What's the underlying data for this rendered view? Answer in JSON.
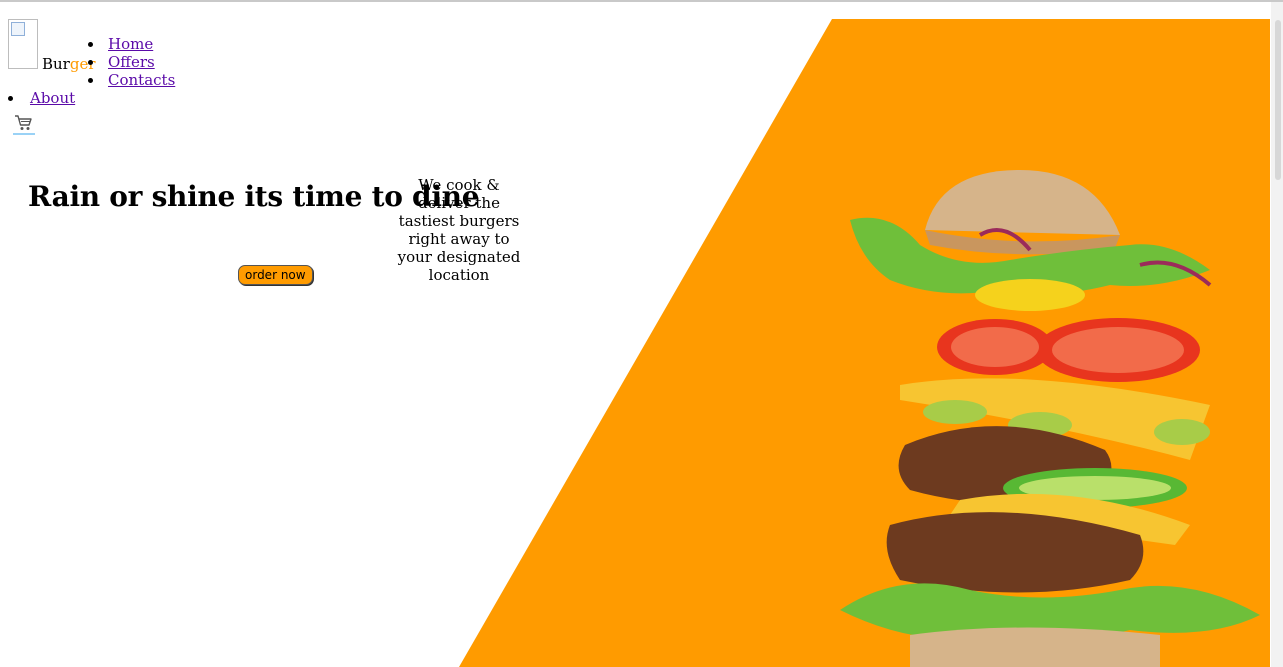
{
  "header": {
    "logo_text_part1": "Bur",
    "logo_text_part2": "ger",
    "nav": [
      {
        "label": "Home"
      },
      {
        "label": "Offers"
      },
      {
        "label": "Contacts"
      }
    ],
    "about_label": "About",
    "cart_icon": "shopping-cart-icon"
  },
  "hero": {
    "title": "Rain or shine its time to dine",
    "description": "We cook & deliver the tastiest burgers right away to your designated location",
    "order_button": "order now"
  },
  "colors": {
    "accent": "#ff9b00",
    "link": "#5a0aa8",
    "background": "#ffffff"
  }
}
